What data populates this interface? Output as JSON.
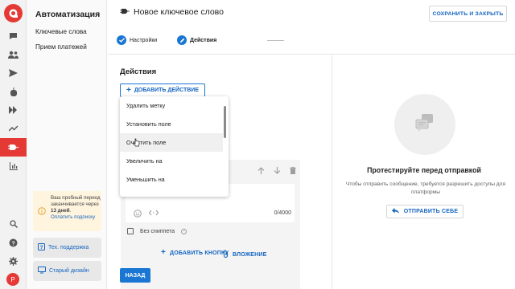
{
  "rail": {
    "icons": [
      "logo-icon",
      "chat-icon",
      "users-icon",
      "send-icon",
      "bot-icon",
      "flows-icon",
      "trending-icon",
      "automation-icon",
      "analytics-icon",
      "search-icon",
      "help-icon",
      "settings-icon"
    ],
    "avatar_letter": "P"
  },
  "sidebar": {
    "title": "Автоматизация",
    "items": [
      {
        "label": "Ключевые слова"
      },
      {
        "label": "Прием платежей"
      }
    ],
    "trial": {
      "line1": "Ваш пробный период заканчивается через ",
      "days": "13 дней",
      "link": "Оплатить подписку"
    },
    "support_label": "Тех. поддержка",
    "old_design_label": "Старый дизайн"
  },
  "header": {
    "title": "Новое ключевое слово",
    "save_label": "СОХРАНИТЬ И ЗАКРЫТЬ",
    "steps": [
      {
        "label": "Настройки",
        "state": "done"
      },
      {
        "label": "Действия",
        "state": "active"
      }
    ]
  },
  "main": {
    "section_title": "Действия",
    "add_action_label": "ДОБАВИТЬ ДЕЙСТВИЕ",
    "counter": "0/4000",
    "snippet_label": "Без сниппета",
    "add_button_label": "ДОБАВИТЬ КНОПКУ",
    "attachment_label": "ВЛОЖЕНИЕ",
    "back_label": "НАЗАД"
  },
  "dropdown": {
    "items": [
      {
        "label": "Удалить метку"
      },
      {
        "label": "Установить поле"
      },
      {
        "label": "Очистить поле"
      },
      {
        "label": "Увеличить на"
      },
      {
        "label": "Уменьшить на"
      }
    ],
    "hovered_index": 2
  },
  "test_panel": {
    "title": "Протестируйте перед отправкой",
    "description": "Чтобы отправить сообщение, требуется разрешить доступы для платформы",
    "send_label": "ОТПРАВИТЬ СЕБЕ"
  },
  "colors": {
    "brand": "#e53935",
    "accent": "#1976d2",
    "link": "#1565c0",
    "trial_bg": "#fff4de"
  }
}
